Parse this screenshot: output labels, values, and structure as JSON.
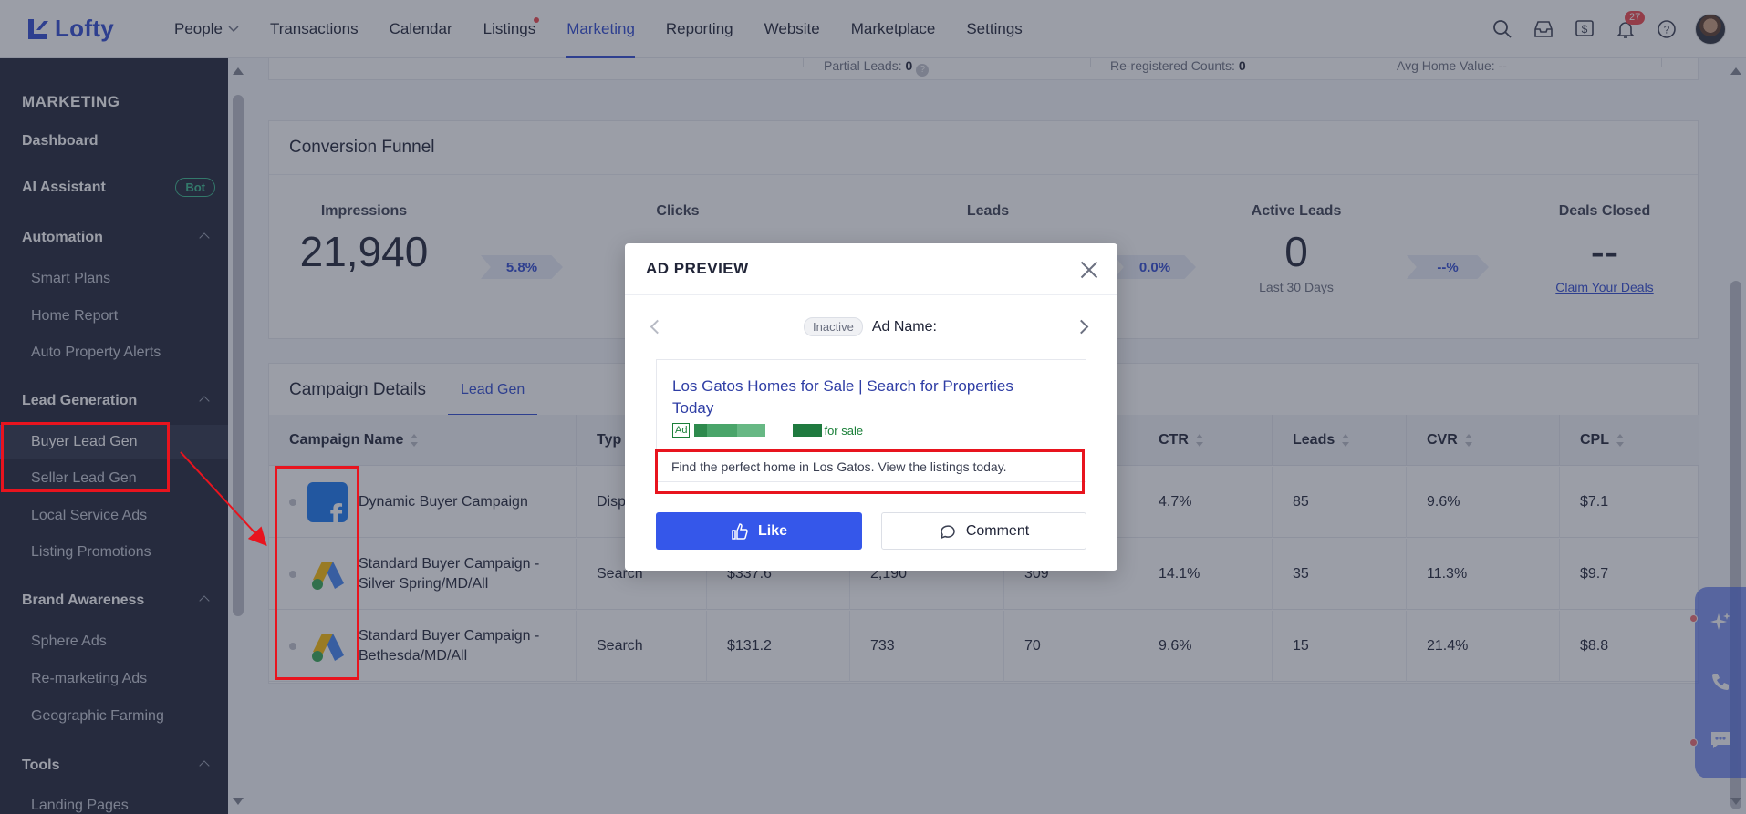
{
  "app": {
    "logo_text": "Lofty"
  },
  "nav": {
    "items": [
      {
        "label": "People",
        "has_dropdown": true
      },
      {
        "label": "Transactions"
      },
      {
        "label": "Calendar"
      },
      {
        "label": "Listings",
        "has_dot": true
      },
      {
        "label": "Marketing",
        "active": true
      },
      {
        "label": "Reporting"
      },
      {
        "label": "Website"
      },
      {
        "label": "Marketplace"
      },
      {
        "label": "Settings"
      }
    ],
    "notifications_count": "27"
  },
  "sidebar": {
    "title": "MARKETING",
    "dashboard": "Dashboard",
    "ai_assistant": "AI Assistant",
    "ai_badge": "Bot",
    "automation": "Automation",
    "smart_plans": "Smart Plans",
    "home_report": "Home Report",
    "auto_property_alerts": "Auto Property Alerts",
    "lead_generation": "Lead Generation",
    "buyer_lead_gen": "Buyer Lead Gen",
    "seller_lead_gen": "Seller Lead Gen",
    "local_service_ads": "Local Service Ads",
    "listing_promotions": "Listing Promotions",
    "brand_awareness": "Brand Awareness",
    "sphere_ads": "Sphere Ads",
    "remarketing_ads": "Re-marketing Ads",
    "geographic_farming": "Geographic Farming",
    "tools": "Tools",
    "landing_pages": "Landing Pages"
  },
  "top_stats": {
    "partial_leads_label": "Partial Leads:",
    "partial_leads_value": "0",
    "reregistered_label": "Re-registered Counts:",
    "reregistered_value": "0",
    "avg_home_value_label": "Avg Home Value:",
    "avg_home_value_value": "--"
  },
  "funnel": {
    "title": "Conversion Funnel",
    "impressions_label": "Impressions",
    "impressions_value": "21,940",
    "impressions_rate": "5.8%",
    "clicks_label": "Clicks",
    "leads_label": "Leads",
    "leads_rate": "0.0%",
    "active_leads_label": "Active Leads",
    "active_leads_value": "0",
    "active_leads_sub": "Last 30 Days",
    "active_rate": "--%",
    "deals_label": "Deals Closed",
    "deals_value": "--",
    "deals_link": "Claim Your Deals"
  },
  "campaigns": {
    "title": "Campaign Details",
    "tab": "Lead Gen",
    "columns": [
      "Campaign Name",
      "Typ",
      "",
      "",
      "",
      "CTR",
      "Leads",
      "CVR",
      "CPL"
    ],
    "rows": [
      {
        "name": "Dynamic Buyer Campaign",
        "type": "Disp",
        "spend": "",
        "impressions": "",
        "clicks": "",
        "ctr": "4.7%",
        "leads": "85",
        "cvr": "9.6%",
        "cpl": "$7.1",
        "platform": "facebook-icon"
      },
      {
        "name": "Standard Buyer Campaign - Silver Spring/MD/All",
        "type": "Search",
        "spend": "$337.6",
        "impressions": "2,190",
        "clicks": "309",
        "ctr": "14.1%",
        "leads": "35",
        "cvr": "11.3%",
        "cpl": "$9.7",
        "platform": "google-ads-icon"
      },
      {
        "name": "Standard Buyer Campaign - Bethesda/MD/All",
        "type": "Search",
        "spend": "$131.2",
        "impressions": "733",
        "clicks": "70",
        "ctr": "9.6%",
        "leads": "15",
        "cvr": "21.4%",
        "cpl": "$8.8",
        "platform": "google-ads-icon"
      }
    ]
  },
  "modal": {
    "title": "AD PREVIEW",
    "status": "Inactive",
    "ad_name_label": "Ad Name:",
    "headline": "Los Gatos Homes for Sale | Search for Properties Today",
    "ad_tag": "Ad",
    "url_suffix": "for sale",
    "description": "Find the perfect home in Los Gatos. View the listings today.",
    "like_label": "Like",
    "comment_label": "Comment"
  },
  "colors": {
    "brand": "#2f49d1",
    "primary_button": "#3557ea",
    "sidebar_bg": "#1f2437",
    "annotation": "#e8141e"
  }
}
